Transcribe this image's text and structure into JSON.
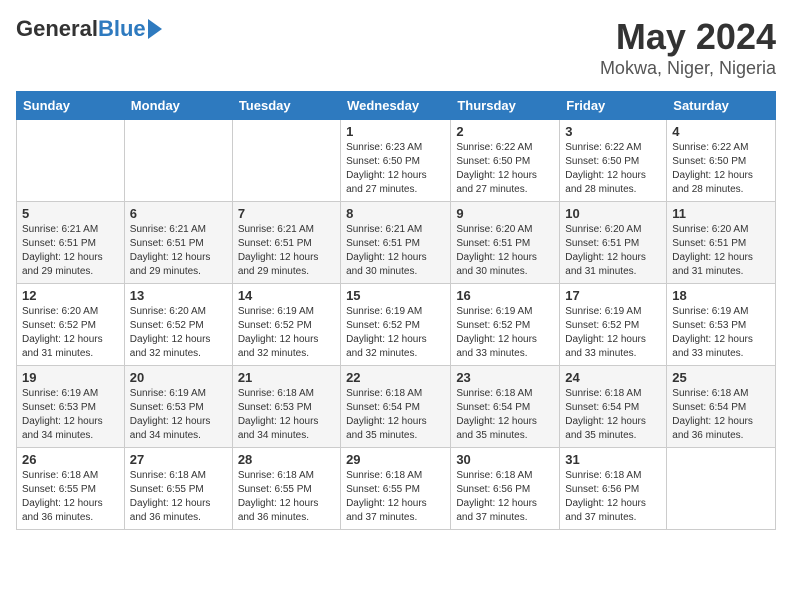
{
  "logo": {
    "general": "General",
    "blue": "Blue"
  },
  "title": "May 2024",
  "subtitle": "Mokwa, Niger, Nigeria",
  "weekdays": [
    "Sunday",
    "Monday",
    "Tuesday",
    "Wednesday",
    "Thursday",
    "Friday",
    "Saturday"
  ],
  "weeks": [
    [
      null,
      null,
      null,
      {
        "day": 1,
        "sunrise": "6:23 AM",
        "sunset": "6:50 PM",
        "daylight": "12 hours and 27 minutes."
      },
      {
        "day": 2,
        "sunrise": "6:22 AM",
        "sunset": "6:50 PM",
        "daylight": "12 hours and 27 minutes."
      },
      {
        "day": 3,
        "sunrise": "6:22 AM",
        "sunset": "6:50 PM",
        "daylight": "12 hours and 28 minutes."
      },
      {
        "day": 4,
        "sunrise": "6:22 AM",
        "sunset": "6:50 PM",
        "daylight": "12 hours and 28 minutes."
      }
    ],
    [
      {
        "day": 5,
        "sunrise": "6:21 AM",
        "sunset": "6:51 PM",
        "daylight": "12 hours and 29 minutes."
      },
      {
        "day": 6,
        "sunrise": "6:21 AM",
        "sunset": "6:51 PM",
        "daylight": "12 hours and 29 minutes."
      },
      {
        "day": 7,
        "sunrise": "6:21 AM",
        "sunset": "6:51 PM",
        "daylight": "12 hours and 29 minutes."
      },
      {
        "day": 8,
        "sunrise": "6:21 AM",
        "sunset": "6:51 PM",
        "daylight": "12 hours and 30 minutes."
      },
      {
        "day": 9,
        "sunrise": "6:20 AM",
        "sunset": "6:51 PM",
        "daylight": "12 hours and 30 minutes."
      },
      {
        "day": 10,
        "sunrise": "6:20 AM",
        "sunset": "6:51 PM",
        "daylight": "12 hours and 31 minutes."
      },
      {
        "day": 11,
        "sunrise": "6:20 AM",
        "sunset": "6:51 PM",
        "daylight": "12 hours and 31 minutes."
      }
    ],
    [
      {
        "day": 12,
        "sunrise": "6:20 AM",
        "sunset": "6:52 PM",
        "daylight": "12 hours and 31 minutes."
      },
      {
        "day": 13,
        "sunrise": "6:20 AM",
        "sunset": "6:52 PM",
        "daylight": "12 hours and 32 minutes."
      },
      {
        "day": 14,
        "sunrise": "6:19 AM",
        "sunset": "6:52 PM",
        "daylight": "12 hours and 32 minutes."
      },
      {
        "day": 15,
        "sunrise": "6:19 AM",
        "sunset": "6:52 PM",
        "daylight": "12 hours and 32 minutes."
      },
      {
        "day": 16,
        "sunrise": "6:19 AM",
        "sunset": "6:52 PM",
        "daylight": "12 hours and 33 minutes."
      },
      {
        "day": 17,
        "sunrise": "6:19 AM",
        "sunset": "6:52 PM",
        "daylight": "12 hours and 33 minutes."
      },
      {
        "day": 18,
        "sunrise": "6:19 AM",
        "sunset": "6:53 PM",
        "daylight": "12 hours and 33 minutes."
      }
    ],
    [
      {
        "day": 19,
        "sunrise": "6:19 AM",
        "sunset": "6:53 PM",
        "daylight": "12 hours and 34 minutes."
      },
      {
        "day": 20,
        "sunrise": "6:19 AM",
        "sunset": "6:53 PM",
        "daylight": "12 hours and 34 minutes."
      },
      {
        "day": 21,
        "sunrise": "6:18 AM",
        "sunset": "6:53 PM",
        "daylight": "12 hours and 34 minutes."
      },
      {
        "day": 22,
        "sunrise": "6:18 AM",
        "sunset": "6:54 PM",
        "daylight": "12 hours and 35 minutes."
      },
      {
        "day": 23,
        "sunrise": "6:18 AM",
        "sunset": "6:54 PM",
        "daylight": "12 hours and 35 minutes."
      },
      {
        "day": 24,
        "sunrise": "6:18 AM",
        "sunset": "6:54 PM",
        "daylight": "12 hours and 35 minutes."
      },
      {
        "day": 25,
        "sunrise": "6:18 AM",
        "sunset": "6:54 PM",
        "daylight": "12 hours and 36 minutes."
      }
    ],
    [
      {
        "day": 26,
        "sunrise": "6:18 AM",
        "sunset": "6:55 PM",
        "daylight": "12 hours and 36 minutes."
      },
      {
        "day": 27,
        "sunrise": "6:18 AM",
        "sunset": "6:55 PM",
        "daylight": "12 hours and 36 minutes."
      },
      {
        "day": 28,
        "sunrise": "6:18 AM",
        "sunset": "6:55 PM",
        "daylight": "12 hours and 36 minutes."
      },
      {
        "day": 29,
        "sunrise": "6:18 AM",
        "sunset": "6:55 PM",
        "daylight": "12 hours and 37 minutes."
      },
      {
        "day": 30,
        "sunrise": "6:18 AM",
        "sunset": "6:56 PM",
        "daylight": "12 hours and 37 minutes."
      },
      {
        "day": 31,
        "sunrise": "6:18 AM",
        "sunset": "6:56 PM",
        "daylight": "12 hours and 37 minutes."
      },
      null
    ]
  ]
}
